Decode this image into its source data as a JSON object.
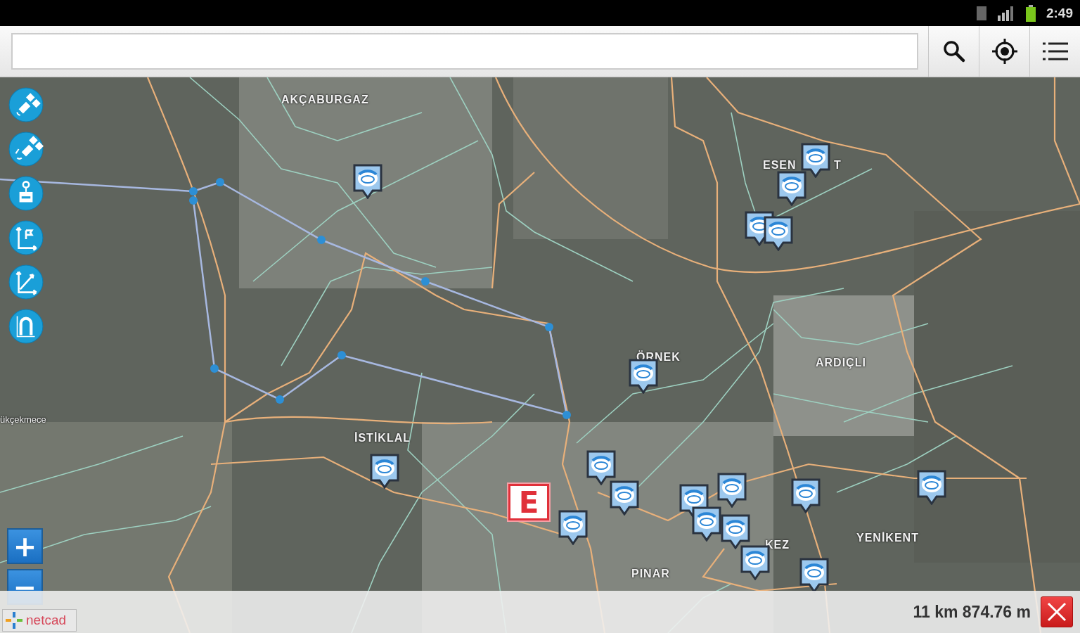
{
  "status_bar": {
    "time": "2:49"
  },
  "toolbar": {
    "buttons": [
      {
        "kind": "search"
      },
      {
        "kind": "locate"
      },
      {
        "kind": "menu"
      }
    ]
  },
  "map": {
    "tools": [
      {
        "kind": "satellite"
      },
      {
        "kind": "satellite-alt"
      },
      {
        "kind": "pin"
      },
      {
        "kind": "axes-flag"
      },
      {
        "kind": "axes-line"
      },
      {
        "kind": "magnet"
      }
    ],
    "labels": [
      "AKÇABURGAZ",
      "ESEN",
      "T",
      "ÖRNEK",
      "ARDIÇLI",
      "ükçekmece",
      "İSTİKLAL",
      "YENİKENT",
      "KEZ",
      "PINAR"
    ],
    "poi_sign": "E",
    "zoom_in": "+",
    "zoom_out": "−",
    "logo": "netcad"
  },
  "measurement": {
    "distance": "11 km 874.76 m"
  }
}
